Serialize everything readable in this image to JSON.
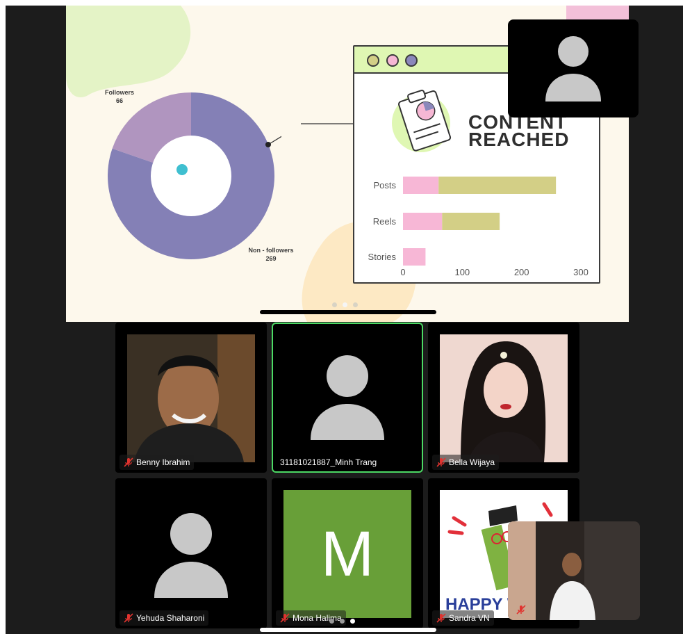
{
  "presentation": {
    "donut": {
      "segments": [
        {
          "label": "Followers",
          "value": 66,
          "color": "#b095bf"
        },
        {
          "label": "Non - followers",
          "value": 269,
          "color": "#8480b6"
        }
      ]
    },
    "card": {
      "title_line1": "CONTENT",
      "title_line2": "REACHED",
      "window_dots": [
        "#d3cf87",
        "#f6b7d4",
        "#8b88bb"
      ]
    },
    "chart_data": {
      "type": "bar",
      "orientation": "horizontal",
      "stacked": true,
      "categories": [
        "Posts",
        "Reels",
        "Stories"
      ],
      "series": [
        {
          "values": [
            60,
            66,
            38
          ],
          "color": "#f7b7d6"
        },
        {
          "values": [
            198,
            97,
            0
          ],
          "color": "#d3cf86"
        }
      ],
      "xticks": [
        "0",
        "100",
        "200",
        "300"
      ],
      "xlim": [
        0,
        300
      ]
    }
  },
  "participants": [
    {
      "name": "Benny Ibrahim",
      "muted": true,
      "kind": "photo"
    },
    {
      "name": "31181021887_Minh Trang",
      "muted": false,
      "kind": "placeholder",
      "active_speaker": true
    },
    {
      "name": "Bella Wijaya",
      "muted": true,
      "kind": "photo"
    },
    {
      "name": "Yehuda Shaharoni",
      "muted": true,
      "kind": "placeholder"
    },
    {
      "name": "Mona Halima",
      "muted": true,
      "kind": "letter",
      "initial": "M"
    },
    {
      "name": "Sandra VN",
      "muted": true,
      "kind": "photo"
    }
  ],
  "sandra_tile_image_text": "HAPPY WIT",
  "colors": {
    "active_speaker": "#4cd964",
    "mic_off": "#e0332f",
    "avatar_gray": "#c8c8c8",
    "mona_bg": "#689f38"
  }
}
